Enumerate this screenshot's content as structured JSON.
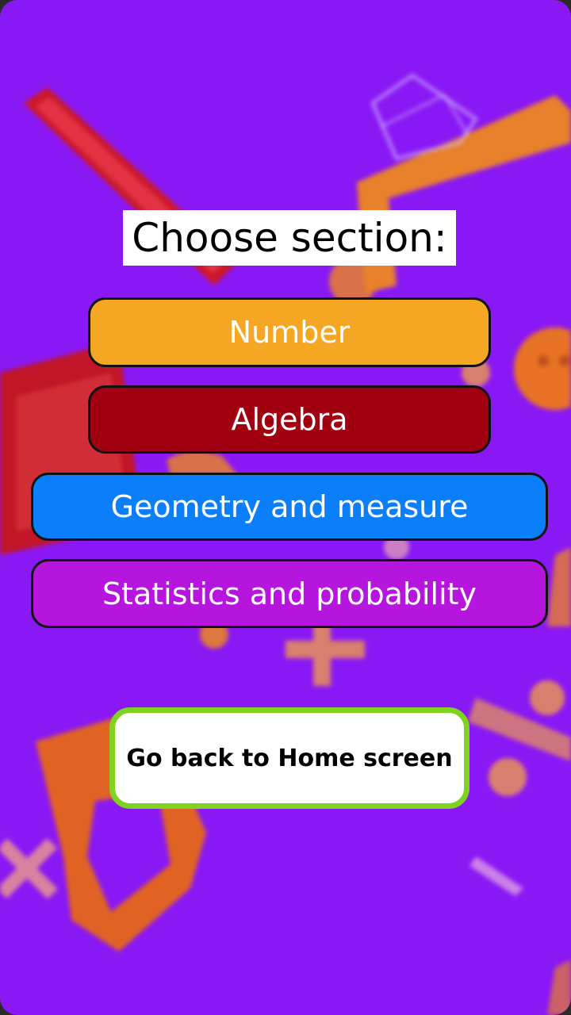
{
  "screen": {
    "title": "Choose section:",
    "background_color": "#8a18f4"
  },
  "sections": [
    {
      "label": "Number",
      "color": "#f5a623"
    },
    {
      "label": "Algebra",
      "color": "#a00010"
    },
    {
      "label": "Geometry and measure",
      "color": "#0b7ff9"
    },
    {
      "label": "Statistics and probability",
      "color": "#b515dc"
    }
  ],
  "home_button": {
    "label": "Go back to Home screen",
    "border_color": "#7ed321"
  },
  "background_icons": [
    "ruler-icon",
    "triangle-icon",
    "pencil-icon",
    "plus-icon",
    "smiley-icon",
    "compass-icon"
  ]
}
